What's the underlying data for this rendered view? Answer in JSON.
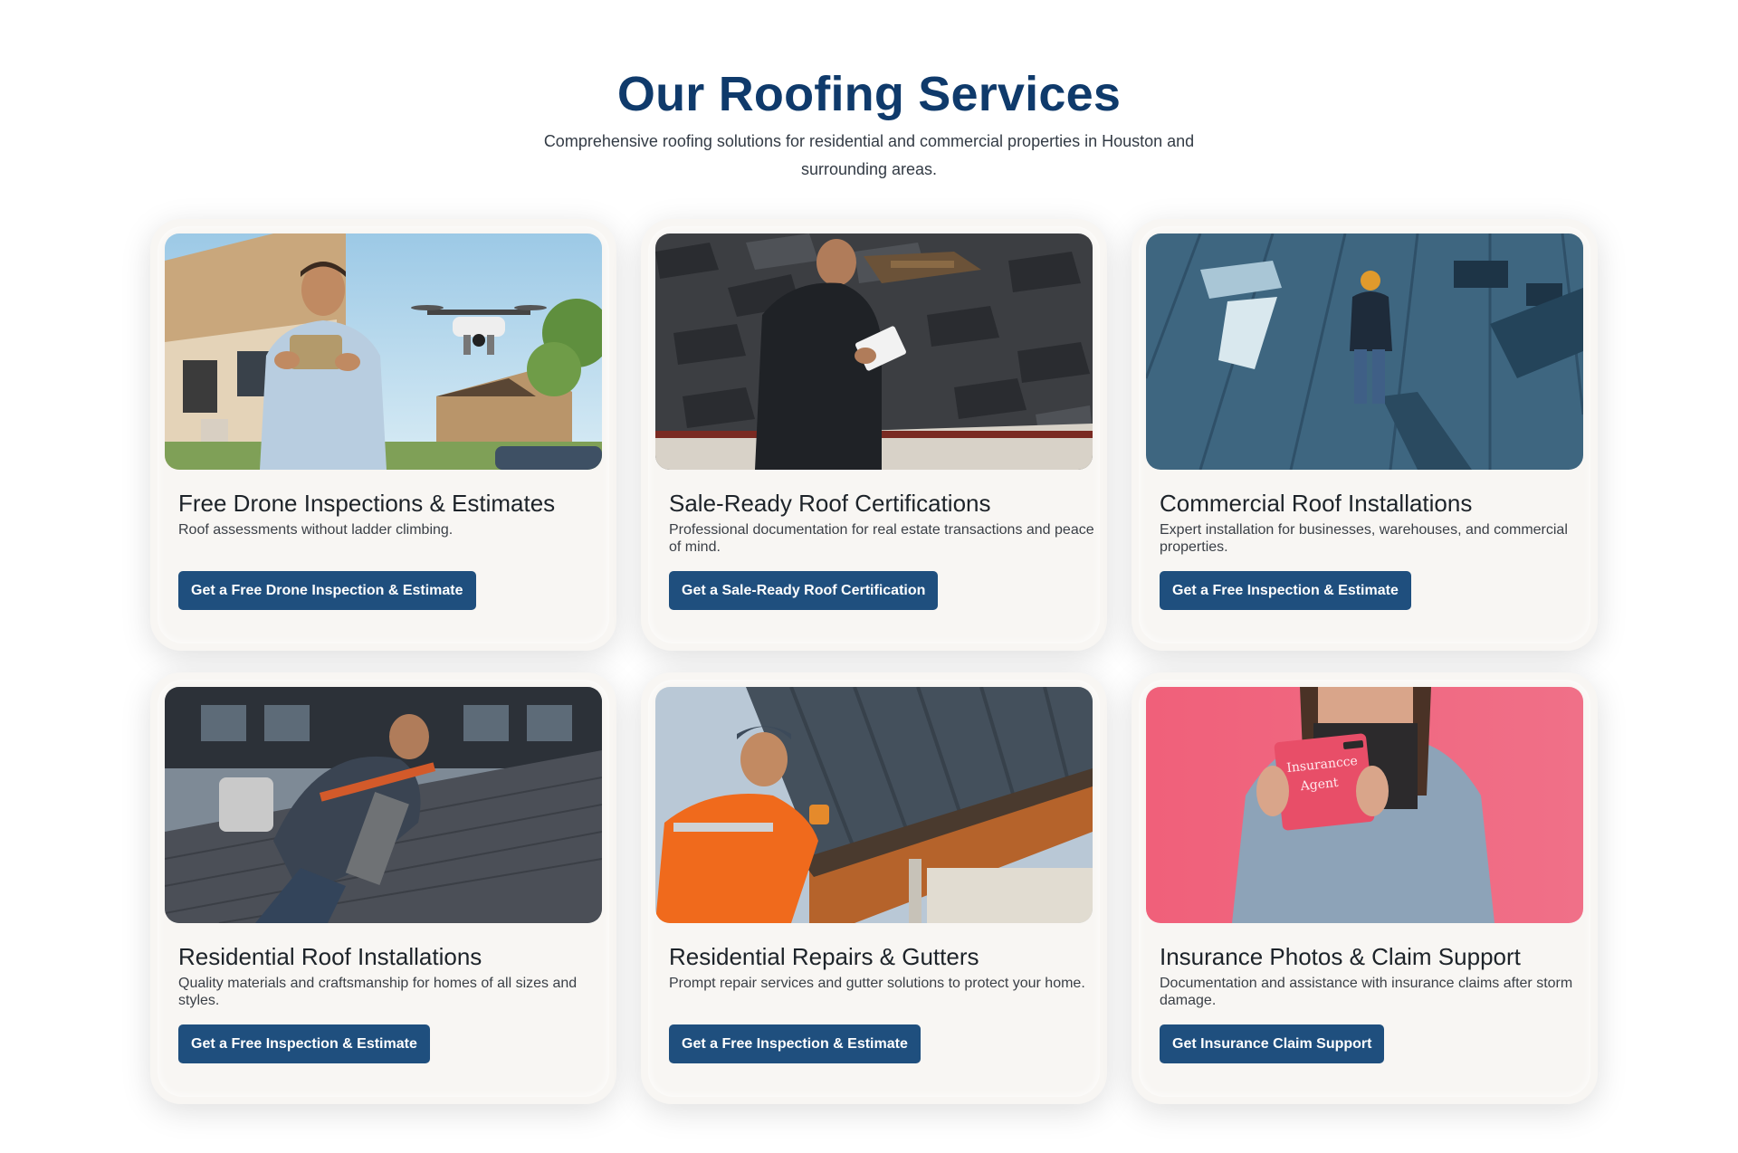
{
  "section": {
    "title": "Our Roofing Services",
    "subtitle": "Comprehensive roofing solutions for residential and commercial properties in Houston and surrounding areas."
  },
  "cards": [
    {
      "title": "Free Drone Inspections & Estimates",
      "description": "Roof assessments without ladder climbing.",
      "button": "Get a Free Drone Inspection & Estimate",
      "image": "smiling-man-with-tablet-and-drone-photo"
    },
    {
      "title": "Sale-Ready Roof Certifications",
      "description": "Professional documentation for real estate transactions and peace of mind.",
      "button": "Get a Sale-Ready Roof Certification",
      "image": "inspector-with-clipboard-on-damaged-shingle-roof-photo"
    },
    {
      "title": "Commercial Roof Installations",
      "description": "Expert installation for businesses, warehouses, and commercial properties.",
      "button": "Get a Free Inspection & Estimate",
      "image": "worker-on-flat-commercial-roof-photo"
    },
    {
      "title": "Residential Roof Installations",
      "description": "Quality materials and craftsmanship for homes of all sizes and styles.",
      "button": "Get a Free Inspection & Estimate",
      "image": "roofer-with-nail-gun-on-shingles-photo"
    },
    {
      "title": "Residential Repairs & Gutters",
      "description": "Prompt repair services and gutter solutions to protect your home.",
      "button": "Get a Free Inspection & Estimate",
      "image": "worker-installing-gutter-photo"
    },
    {
      "title": "Insurance Photos & Claim Support",
      "description": "Documentation and assistance with insurance claims after storm damage.",
      "button": "Get Insurance Claim Support",
      "image": "woman-holding-insurance-agent-card-photo",
      "image_text": "Insurancce Agent"
    }
  ]
}
